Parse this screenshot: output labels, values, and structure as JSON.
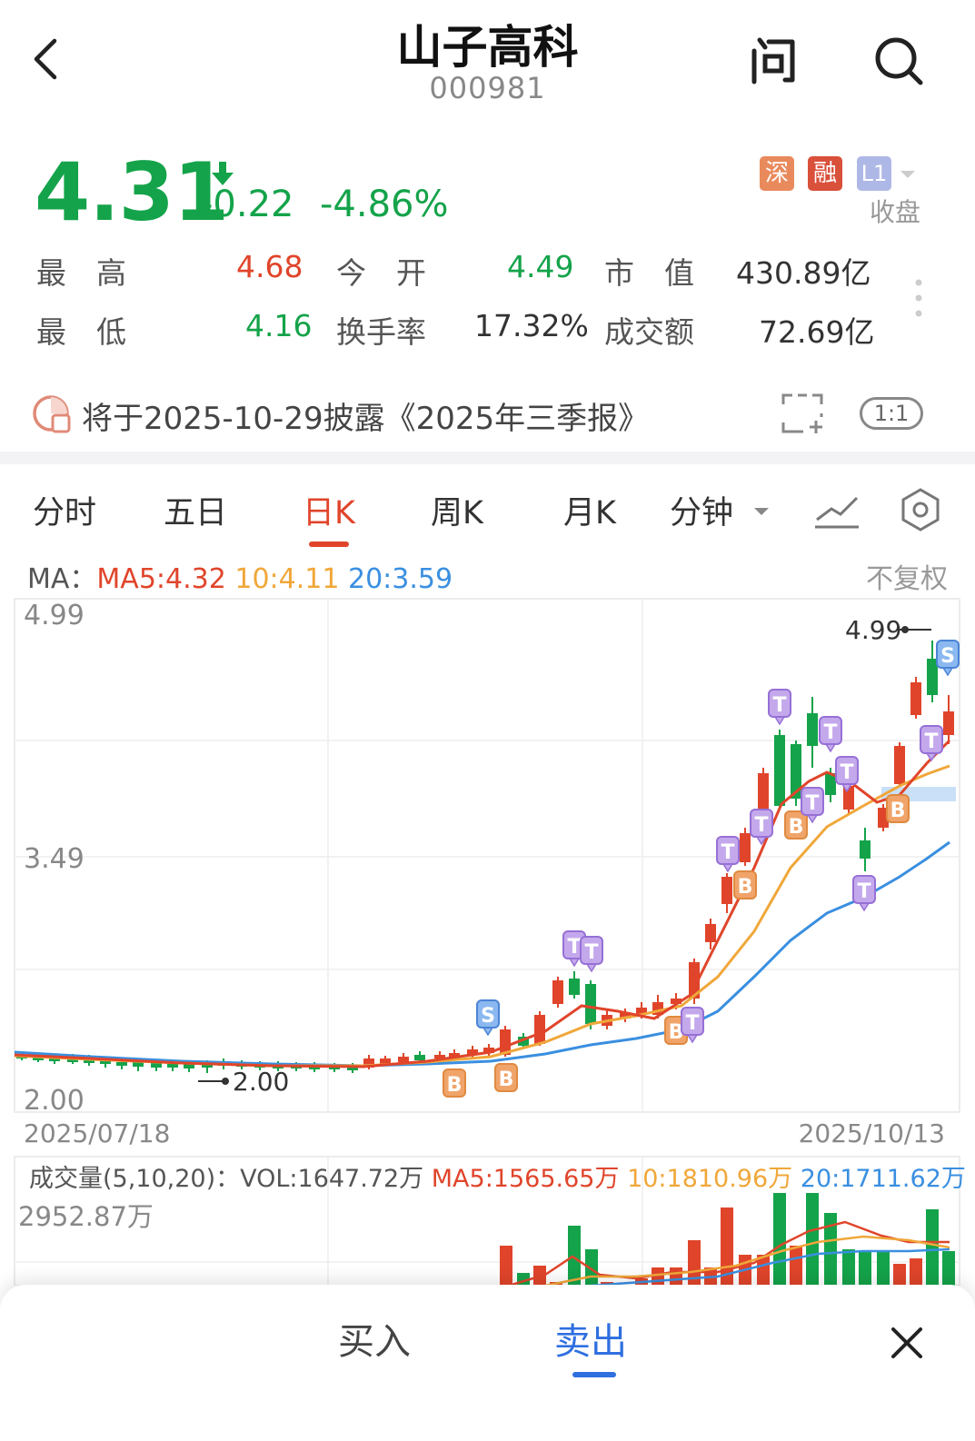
{
  "header": {
    "title": "山子高科",
    "code": "000981"
  },
  "quote": {
    "price": "4.31",
    "change": "-0.22",
    "change_pct": "-4.86%",
    "badges": [
      "深",
      "融",
      "L1"
    ],
    "status": "收盘",
    "high_label": "最　高",
    "high": "4.68",
    "open_label": "今　开",
    "open": "4.49",
    "mcap_label": "市　值",
    "mcap": "430.89亿",
    "low_label": "最　低",
    "low": "4.16",
    "turnover_label": "换手率",
    "turnover": "17.32%",
    "amount_label": "成交额",
    "amount": "72.69亿"
  },
  "notice": {
    "text": "将于2025-10-29披露《2025年三季报》",
    "ratio": "1:1"
  },
  "tabs": [
    "分时",
    "五日",
    "日K",
    "周K",
    "月K",
    "分钟"
  ],
  "active_tab": "日K",
  "ma": {
    "label": "MA：",
    "ma5": "MA5:4.32",
    "ma10": "10:4.11",
    "ma20": "20:3.59",
    "adjust": "不复权"
  },
  "axis": {
    "top": "4.99",
    "mid": "3.49",
    "bottom": "2.00",
    "start_date": "2025/07/18",
    "end_date": "2025/10/13",
    "max_marker": "4.99",
    "min_marker": "2.00"
  },
  "volume": {
    "label": "成交量(5,10,20)：",
    "vol": "VOL:1647.72万",
    "ma5": "MA5:1565.65万",
    "ma10": "10:1810.96万",
    "ma20": "20:1711.62万",
    "max": "2952.87万"
  },
  "colors": {
    "up": "#e0452b",
    "down": "#14a34a",
    "ma5": "#e0452b",
    "ma10": "#f0a73a",
    "ma20": "#3a8fe0",
    "accent": "#2f6fe0"
  },
  "sheet": {
    "buy": "买入",
    "sell": "卖出"
  }
}
